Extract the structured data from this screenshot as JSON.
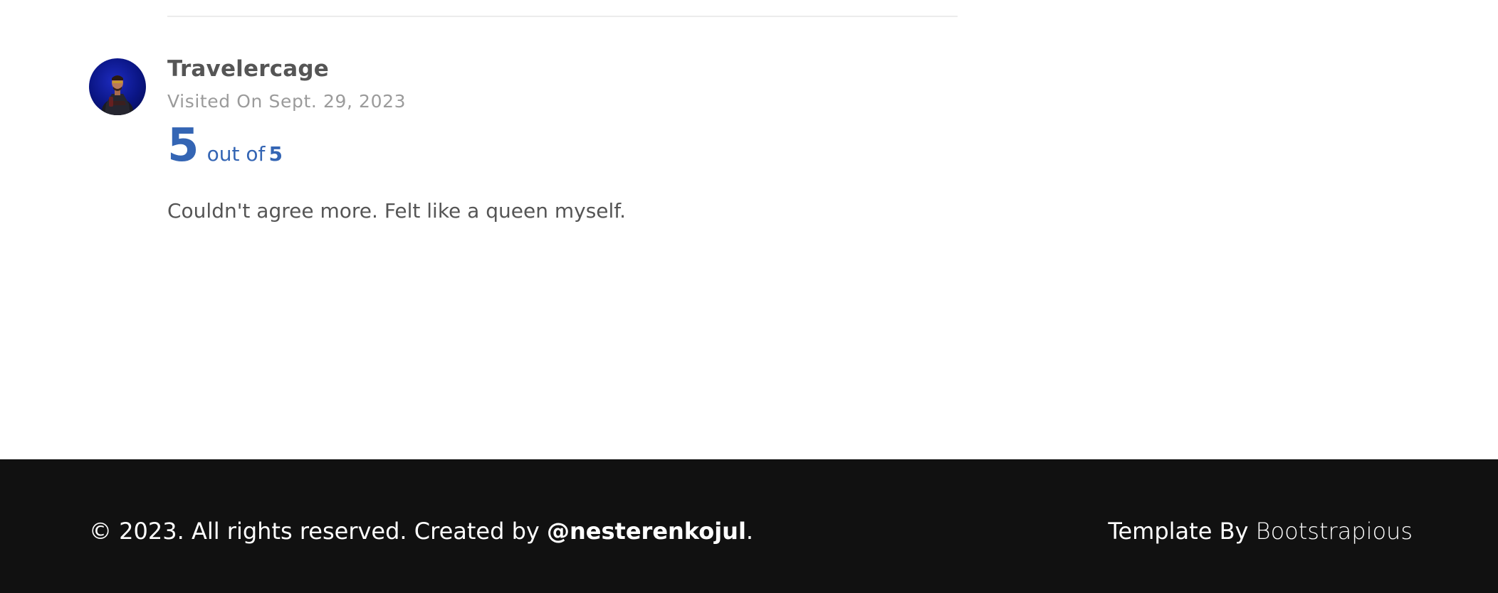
{
  "review": {
    "reviewer_name": "Travelercage",
    "visit_label": "Visited On Sept. 29, 2023",
    "rating": {
      "score": "5",
      "out_of_text": "out of",
      "max": "5"
    },
    "text": "Couldn't agree more. Felt like a queen myself."
  },
  "footer": {
    "copyright_text": "© 2023. All rights reserved. Created by ",
    "author_handle": "@nesterenkojul",
    "period": ".",
    "template_prefix": "Template By ",
    "template_brand": "Bootstrapious"
  },
  "colors": {
    "accent": "#3465b4",
    "text": "#555555",
    "muted": "#9b9b9b",
    "footer_bg": "#111111"
  }
}
